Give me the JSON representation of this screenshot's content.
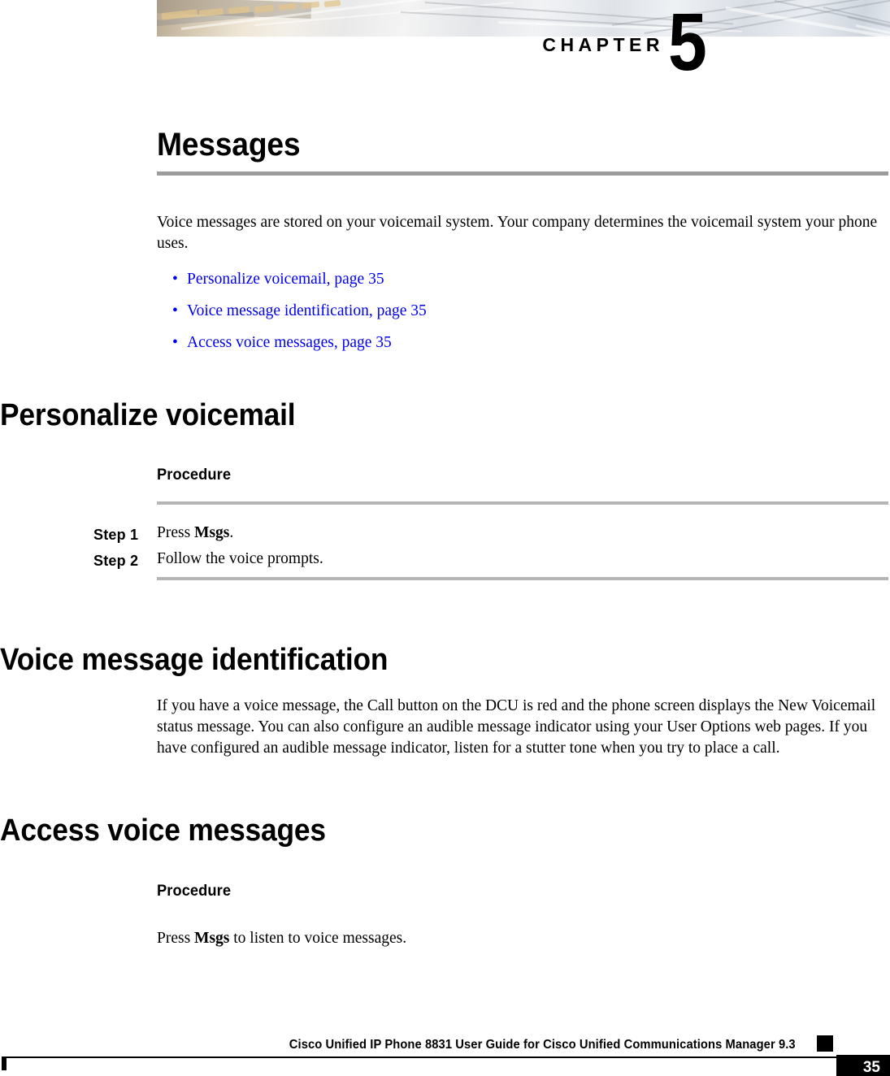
{
  "chapter": {
    "label": "CHAPTER",
    "number": "5"
  },
  "title": "Messages",
  "intro": "Voice messages are stored on your voicemail system. Your company determines the voicemail system your phone uses.",
  "toc_links": [
    {
      "text": "Personalize voicemail,  page  35"
    },
    {
      "text": "Voice message identification,  page  35"
    },
    {
      "text": "Access voice messages,  page  35"
    }
  ],
  "bullet_glyph": "•",
  "sections": [
    {
      "heading": "Personalize voicemail",
      "procedure_label": "Procedure",
      "steps": [
        {
          "label": "Step 1",
          "text_before": "Press ",
          "bold": "Msgs",
          "text_after": "."
        },
        {
          "label": "Step 2",
          "text_before": "Follow the voice prompts.",
          "bold": "",
          "text_after": ""
        }
      ]
    },
    {
      "heading": "Voice message identification",
      "paragraph": "If you have a voice message, the Call button on the DCU is red and the phone screen displays the New Voicemail status message. You can also configure an audible message indicator using your User Options web pages. If you have configured an audible message indicator, listen for a stutter tone when you try to place a call."
    },
    {
      "heading": "Access voice messages",
      "procedure_label": "Procedure",
      "body_before": "Press ",
      "body_bold": "Msgs",
      "body_after": " to listen to voice messages."
    }
  ],
  "footer": {
    "text": "Cisco Unified IP Phone 8831 User Guide for Cisco Unified Communications Manager 9.3",
    "page_number": "35"
  },
  "colors": {
    "link": "#0000ee",
    "rule_dark": "#9c9c9c",
    "rule_light": "#b5b5b5"
  }
}
